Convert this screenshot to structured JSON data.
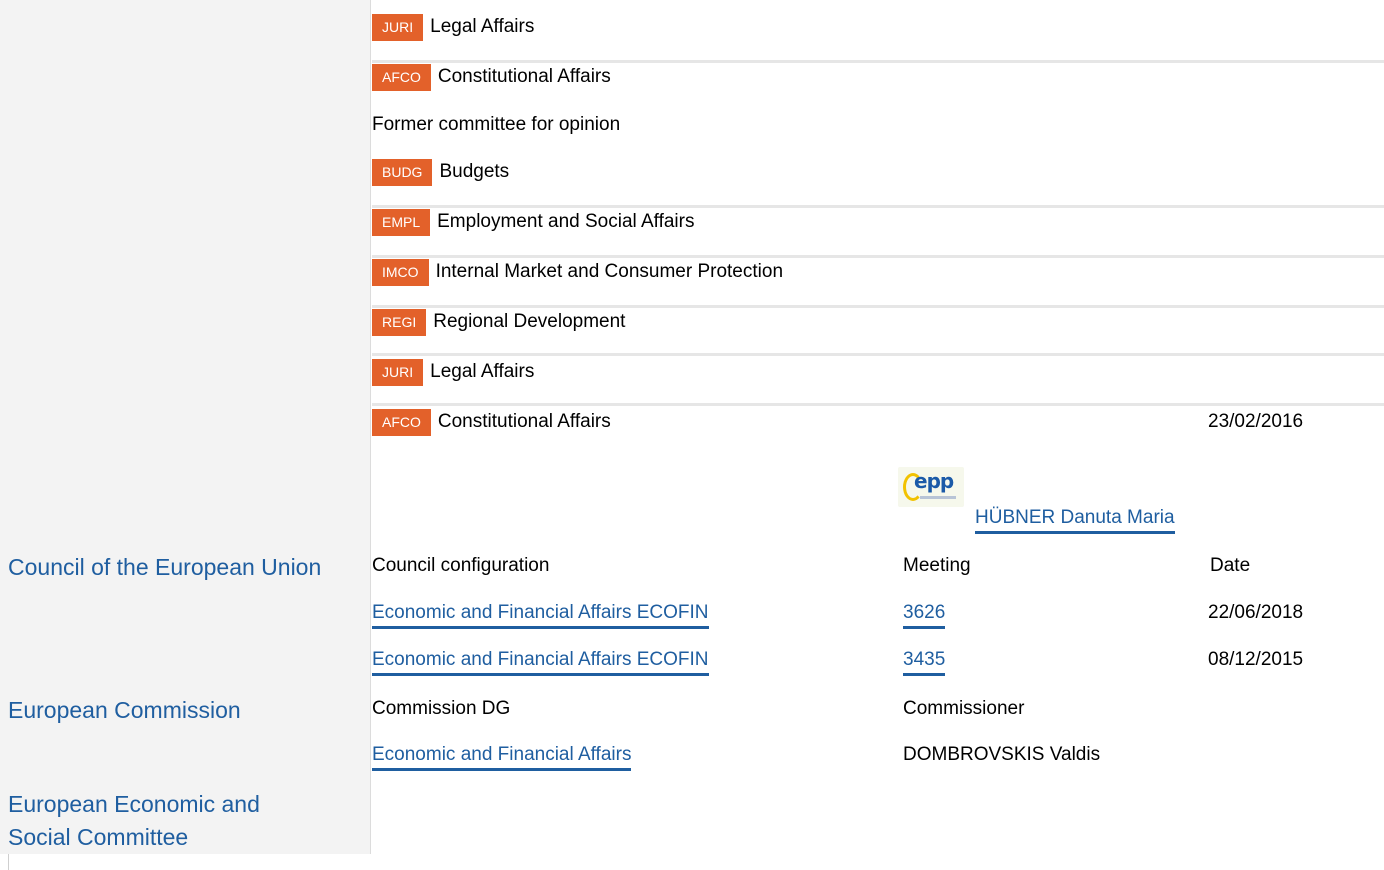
{
  "responsible": [
    {
      "code": "JURI",
      "name": "Legal Affairs"
    },
    {
      "code": "AFCO",
      "name": "Constitutional Affairs"
    }
  ],
  "former_heading": "Former committee for opinion",
  "former": [
    {
      "code": "BUDG",
      "name": "Budgets"
    },
    {
      "code": "EMPL",
      "name": "Employment and Social Affairs"
    },
    {
      "code": "IMCO",
      "name": "Internal Market and Consumer Protection"
    },
    {
      "code": "REGI",
      "name": "Regional Development"
    },
    {
      "code": "JURI",
      "name": "Legal Affairs"
    },
    {
      "code": "AFCO",
      "name": "Constitutional Affairs",
      "date": "23/02/2016"
    }
  ],
  "rapporteur": {
    "group_logo": "epp",
    "name": "HÜBNER Danuta Maria"
  },
  "council": {
    "institution": "Council of the European Union",
    "headers": {
      "configuration": "Council configuration",
      "meeting": "Meeting",
      "date": "Date"
    },
    "rows": [
      {
        "configuration": "Economic and Financial Affairs ECOFIN",
        "meeting": "3626",
        "date": "22/06/2018"
      },
      {
        "configuration": "Economic and Financial Affairs ECOFIN",
        "meeting": "3435",
        "date": "08/12/2015"
      }
    ]
  },
  "commission": {
    "institution": "European Commission",
    "headers": {
      "dg": "Commission DG",
      "commissioner": "Commissioner"
    },
    "row": {
      "dg": "Economic and Financial Affairs",
      "commissioner": "DOMBROVSKIS Valdis"
    }
  },
  "eesc": {
    "institution_line1": "European Economic and",
    "institution_line2": "Social Committee"
  },
  "colors": {
    "badge": "#e3612a",
    "link": "#1f5ea0",
    "left_column": "#f3f3f3"
  }
}
